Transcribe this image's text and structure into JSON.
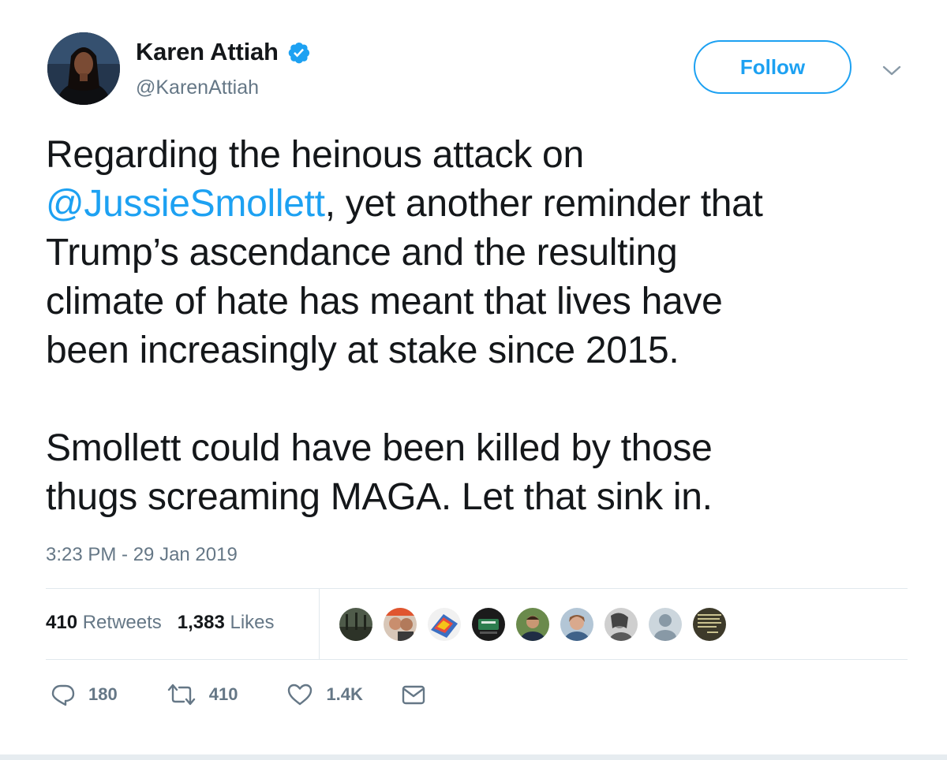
{
  "user": {
    "display_name": "Karen Attiah",
    "handle": "@KarenAttiah",
    "verified": true
  },
  "follow_button": {
    "label": "Follow"
  },
  "tweet": {
    "lines_1": [
      "Regarding the heinous attack on",
      ", yet another reminder that",
      "Trump’s ascendance and the resulting",
      "climate of hate has meant that lives have",
      "been increasingly at stake since 2015."
    ],
    "mention": "@JussieSmollett",
    "lines_2": [
      "Smollett could have been killed by those",
      "thugs screaming MAGA. Let that sink in."
    ],
    "timestamp": "3:23 PM - 29 Jan 2019"
  },
  "stats": {
    "retweets_count": "410",
    "retweets_label": "Retweets",
    "likes_count": "1,383",
    "likes_label": "Likes"
  },
  "actions": {
    "reply_count": "180",
    "retweet_count": "410",
    "like_count": "1.4K"
  },
  "colors": {
    "accent": "#1da1f2",
    "text": "#14171a",
    "secondary": "#657786",
    "divider": "#e1e8ed"
  },
  "icons": {
    "verified": "verified-badge-icon",
    "caret": "chevron-down-icon",
    "reply": "reply-icon",
    "retweet": "retweet-icon",
    "like": "heart-icon",
    "dm": "envelope-icon"
  }
}
